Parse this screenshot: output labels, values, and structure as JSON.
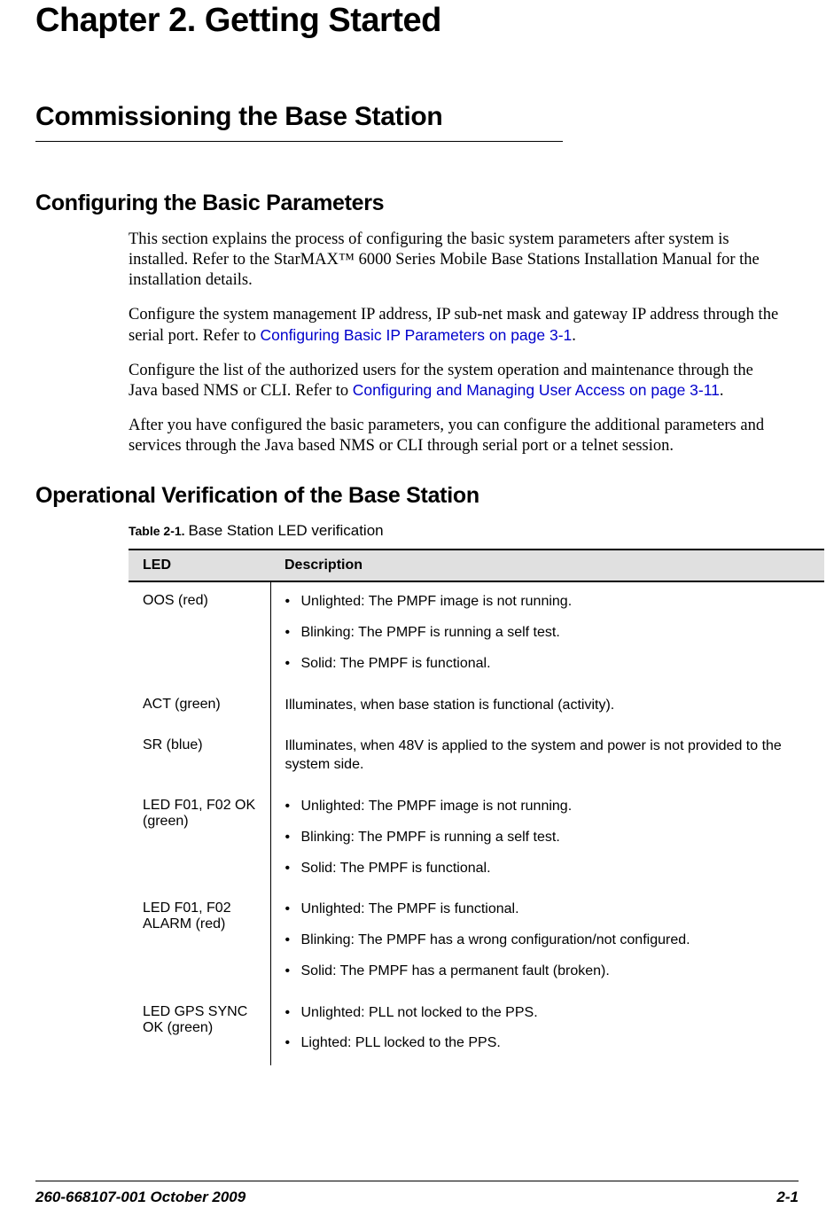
{
  "chapter_title": "Chapter 2. Getting Started",
  "section_title": "Commissioning the Base Station",
  "subsection1": {
    "title": "Configuring the Basic Parameters",
    "para1": "This section explains the process of configuring the basic system parameters after system is installed. Refer to the StarMAX™ 6000 Series Mobile Base Stations Installation Manual for the installation details.",
    "para2_a": "Configure the system management IP address, IP sub-net mask and gateway IP address through the serial port. Refer to ",
    "para2_link": "Configuring Basic IP Parameters on page 3-1",
    "para2_b": ".",
    "para3_a": "Configure the list of the authorized users for the system operation and maintenance through the Java based NMS or CLI. Refer to ",
    "para3_link": "Configuring and Managing User Access on page 3-11",
    "para3_b": ".",
    "para4": "After you have configured the basic parameters, you can configure the additional parameters and services through the Java based NMS or CLI through serial port or a telnet session."
  },
  "subsection2": {
    "title": "Operational Verification of the Base Station",
    "table_caption_label": "Table 2-1. ",
    "table_caption_text": "Base Station LED verification",
    "table": {
      "headers": {
        "led": "LED",
        "description": "Description"
      },
      "rows": [
        {
          "led": "OOS (red)",
          "type": "bullets",
          "items": [
            "Unlighted: The PMPF image is not running.",
            "Blinking: The PMPF is running a self test.",
            "Solid: The PMPF is functional."
          ]
        },
        {
          "led": "ACT (green)",
          "type": "plain",
          "text": "Illuminates, when base station is functional (activity)."
        },
        {
          "led": "SR (blue)",
          "type": "plain",
          "text": "Illuminates, when 48V is applied to the system and power is not provided to the system side."
        },
        {
          "led": "LED F01, F02 OK (green)",
          "type": "bullets",
          "items": [
            "Unlighted: The PMPF image is not running.",
            "Blinking: The PMPF is running a self test.",
            "Solid: The PMPF is functional."
          ]
        },
        {
          "led": "LED F01, F02 ALARM (red)",
          "type": "bullets",
          "items": [
            "Unlighted: The PMPF is functional.",
            "Blinking: The PMPF has a wrong configuration/not configured.",
            "Solid: The PMPF has a permanent fault (broken)."
          ]
        },
        {
          "led": "LED GPS SYNC OK (green)",
          "type": "bullets",
          "items": [
            "Unlighted: PLL not locked to the PPS.",
            "Lighted: PLL locked to the PPS."
          ]
        }
      ]
    }
  },
  "footer": {
    "left": "260-668107-001 October 2009",
    "right": "2-1"
  }
}
